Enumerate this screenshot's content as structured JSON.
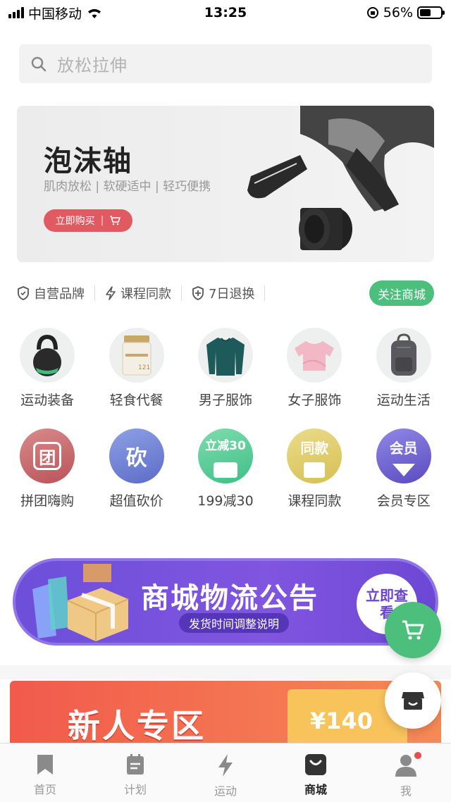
{
  "status_bar": {
    "carrier": "中国移动",
    "time": "13:25",
    "battery": "56%"
  },
  "search": {
    "placeholder": "放松拉伸"
  },
  "hero": {
    "title": "泡沫轴",
    "subtitle": "肌肉放松 | 软硬适中 | 轻巧便携",
    "button": "立即购买"
  },
  "features": [
    {
      "label": "自营品牌",
      "icon": "shield-icon"
    },
    {
      "label": "课程同款",
      "icon": "lightning-icon"
    },
    {
      "label": "7日退换",
      "icon": "shield-plus-icon"
    }
  ],
  "follow_button": "关注商城",
  "categories_row1": [
    {
      "label": "运动装备",
      "icon": "kettlebell-icon"
    },
    {
      "label": "轻食代餐",
      "icon": "meal-jar-icon"
    },
    {
      "label": "男子服饰",
      "icon": "mens-shirt-icon"
    },
    {
      "label": "女子服饰",
      "icon": "womens-top-icon"
    },
    {
      "label": "运动生活",
      "icon": "backpack-icon"
    }
  ],
  "categories_row2": [
    {
      "label": "拼团嗨购",
      "glyph": "团",
      "icon": "group-buy-icon"
    },
    {
      "label": "超值砍价",
      "glyph": "砍",
      "icon": "bargain-icon"
    },
    {
      "label": "199减30",
      "glyph": "立减30",
      "icon": "discount-icon"
    },
    {
      "label": "课程同款",
      "glyph": "同款",
      "icon": "course-same-icon"
    },
    {
      "label": "会员专区",
      "glyph": "会员",
      "icon": "member-icon"
    }
  ],
  "notice": {
    "title": "商城物流公告",
    "subtitle": "发货时间调整说明",
    "button": "立即查看"
  },
  "new_user": {
    "title": "新人专区",
    "coupon": "¥140"
  },
  "tabs": [
    {
      "label": "首页",
      "icon": "bookmark-icon",
      "active": false
    },
    {
      "label": "计划",
      "icon": "plan-icon",
      "active": false
    },
    {
      "label": "运动",
      "icon": "lightning-icon",
      "active": false
    },
    {
      "label": "商城",
      "icon": "shop-bag-icon",
      "active": true
    },
    {
      "label": "我",
      "icon": "profile-icon",
      "active": false
    }
  ],
  "colors": {
    "accent_green": "#4cbf7c",
    "hero_button": "#e05a62",
    "notice_purple": "#6d4fd9"
  }
}
